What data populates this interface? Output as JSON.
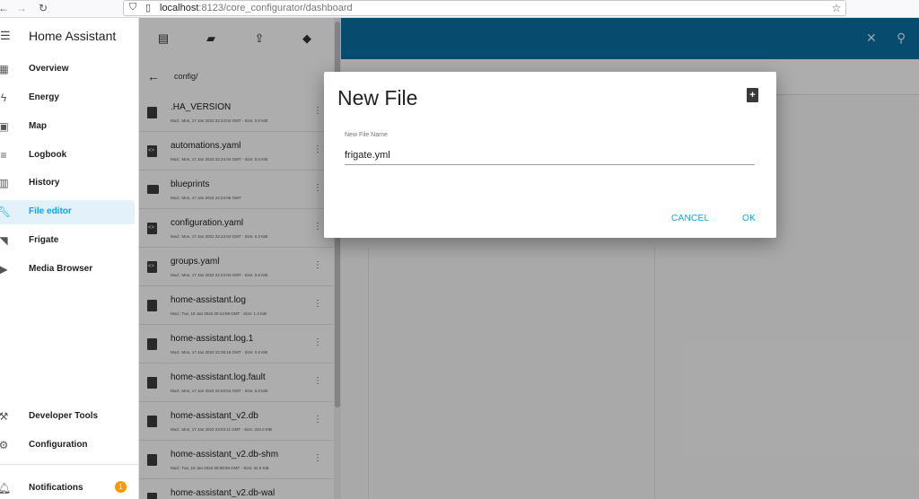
{
  "browser": {
    "url_host": "localhost",
    "url_rest": ":8123/core_configurator/dashboard",
    "back_icon": "back-arrow-icon",
    "forward_icon": "forward-arrow-icon",
    "reload_icon": "reload-icon",
    "bookmark_icon": "star-icon"
  },
  "sidebar": {
    "title": "Home Assistant",
    "items": [
      {
        "label": "Overview",
        "icon": "dashboard-icon"
      },
      {
        "label": "Energy",
        "icon": "lightning-icon"
      },
      {
        "label": "Map",
        "icon": "map-icon"
      },
      {
        "label": "Logbook",
        "icon": "list-icon"
      },
      {
        "label": "History",
        "icon": "chart-icon"
      },
      {
        "label": "File editor",
        "icon": "wrench-icon",
        "active": true
      },
      {
        "label": "Frigate",
        "icon": "cctv-icon"
      },
      {
        "label": "Media Browser",
        "icon": "play-icon"
      }
    ],
    "bottom_items": [
      {
        "label": "Developer Tools",
        "icon": "hammer-icon"
      },
      {
        "label": "Configuration",
        "icon": "cog-icon"
      },
      {
        "label": "Notifications",
        "icon": "bell-icon",
        "badge": "1"
      }
    ]
  },
  "file_browser": {
    "path": "config/",
    "files": [
      {
        "name": ".HA_VERSION",
        "meta": "Mod.: Mon, 17 Jan 2022 22:24:04 GMT · Size: 0.0 KiB",
        "type": "file"
      },
      {
        "name": "automations.yaml",
        "meta": "Mod.: Mon, 17 Jan 2022 22:24:04 GMT · Size: 0.0 KiB",
        "type": "code"
      },
      {
        "name": "blueprints",
        "meta": "Mod.: Mon, 17 Jan 2022 22:24:06 GMT",
        "type": "folder"
      },
      {
        "name": "configuration.yaml",
        "meta": "Mod.: Mon, 17 Jan 2022 22:24:04 GMT · Size: 0.3 KiB",
        "type": "code"
      },
      {
        "name": "groups.yaml",
        "meta": "Mod.: Mon, 17 Jan 2022 22:24:04 GMT · Size: 0.0 KiB",
        "type": "code"
      },
      {
        "name": "home-assistant.log",
        "meta": "Mod.: Tue, 18 Jan 2022 00:14:59 GMT · Size: 1.4 KiB",
        "type": "file"
      },
      {
        "name": "home-assistant.log.1",
        "meta": "Mod.: Mon, 17 Jan 2022 22:38:18 GMT · Size: 0.0 KiB",
        "type": "file"
      },
      {
        "name": "home-assistant.log.fault",
        "meta": "Mod.: Mon, 17 Jan 2022 22:03:54 GMT · Size: 0.0 KiB",
        "type": "file"
      },
      {
        "name": "home-assistant_v2.db",
        "meta": "Mod.: Mon, 17 Jan 2022 23:53:11 GMT · Size: 224.0 KiB",
        "type": "file"
      },
      {
        "name": "home-assistant_v2.db-shm",
        "meta": "Mod.: Tue, 18 Jan 2022 00:08:59 GMT · Size: 32.0 KiB",
        "type": "file"
      },
      {
        "name": "home-assistant_v2.db-wal",
        "meta": "",
        "type": "file"
      }
    ]
  },
  "dialog": {
    "title": "New File",
    "field_label": "New File Name",
    "field_value": "frigate.yml",
    "cancel_label": "CANCEL",
    "ok_label": "OK"
  },
  "colors": {
    "accent": "#03a9f4",
    "header": "#0b6fa4",
    "badge": "#ff9800"
  }
}
